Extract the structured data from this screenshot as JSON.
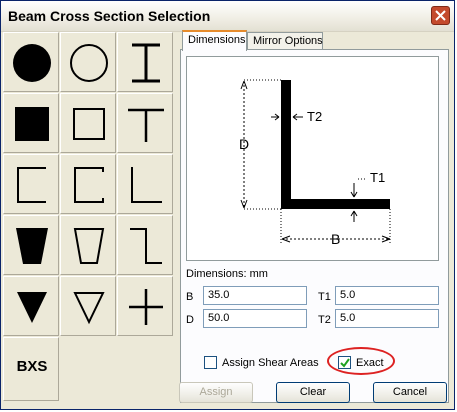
{
  "window": {
    "title": "Beam Cross Section Selection"
  },
  "shapes": [
    {
      "name": "solid-circle"
    },
    {
      "name": "hollow-circle"
    },
    {
      "name": "i-beam"
    },
    {
      "name": "solid-square"
    },
    {
      "name": "hollow-square"
    },
    {
      "name": "tee"
    },
    {
      "name": "channel"
    },
    {
      "name": "lipped-channel"
    },
    {
      "name": "angle"
    },
    {
      "name": "solid-trapezoid"
    },
    {
      "name": "hollow-trapezoid"
    },
    {
      "name": "z-section"
    },
    {
      "name": "solid-triangle"
    },
    {
      "name": "hollow-triangle"
    },
    {
      "name": "cross"
    }
  ],
  "bxs_label": "BXS",
  "tabs": [
    {
      "label": "Dimensions"
    },
    {
      "label": "Mirror Options"
    }
  ],
  "diagram": {
    "d_label": "D",
    "b_label": "B",
    "t1_label": "T1",
    "t2_label": "T2"
  },
  "dimensions": {
    "heading": "Dimensions: mm",
    "b_label": "B",
    "b_value": "35.0",
    "d_label": "D",
    "d_value": "50.0",
    "t1_label": "T1",
    "t1_value": "5.0",
    "t2_label": "T2",
    "t2_value": "5.0"
  },
  "options": {
    "assign_shear_label": "Assign Shear Areas",
    "assign_shear_checked": false,
    "exact_label": "Exact",
    "exact_checked": true
  },
  "buttons": {
    "assign": "Assign",
    "clear": "Clear",
    "cancel": "Cancel"
  },
  "colors": {
    "highlight_ellipse": "#dd2222",
    "tab_accent": "#e68b2c"
  }
}
